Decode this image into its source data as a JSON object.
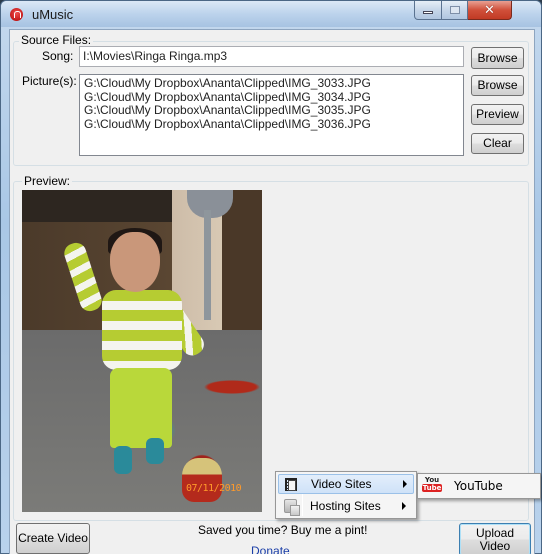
{
  "window": {
    "title": "uMusic",
    "controls": {
      "minimize": "minimize",
      "maximize": "maximize",
      "close": "close"
    }
  },
  "source_files": {
    "legend": "Source Files:",
    "song_label": "Song:",
    "song_value": "I:\\Movies\\Ringa Ringa.mp3",
    "song_browse": "Browse",
    "pictures_label": "Picture(s):",
    "pictures": [
      "G:\\Cloud\\My Dropbox\\Ananta\\Clipped\\IMG_3033.JPG",
      "G:\\Cloud\\My Dropbox\\Ananta\\Clipped\\IMG_3034.JPG",
      "G:\\Cloud\\My Dropbox\\Ananta\\Clipped\\IMG_3035.JPG",
      "G:\\Cloud\\My Dropbox\\Ananta\\Clipped\\IMG_3036.JPG"
    ],
    "pictures_browse": "Browse",
    "preview_button": "Preview",
    "clear_button": "Clear"
  },
  "preview": {
    "legend": "Preview:",
    "image_datestamp": "07/11/2010"
  },
  "footer": {
    "create_video": "Create Video",
    "status_text": "Saved you time? Buy me a pint!",
    "donate_link": "Donate",
    "upload_video": "Upload Video"
  },
  "context_menu": {
    "items": [
      {
        "label": "Video Sites",
        "icon": "film-icon",
        "has_submenu": true,
        "highlighted": true
      },
      {
        "label": "Hosting Sites",
        "icon": "hosting-icon",
        "has_submenu": true,
        "highlighted": false
      }
    ],
    "submenu": {
      "items": [
        {
          "label": "YouTube",
          "icon": "youtube-icon",
          "icon_text_top": "You",
          "icon_text_bottom": "Tube"
        }
      ]
    }
  },
  "colors": {
    "link": "#1a3ea8",
    "menu_highlight": "#cfe2f8",
    "close_button": "#c13a24"
  }
}
